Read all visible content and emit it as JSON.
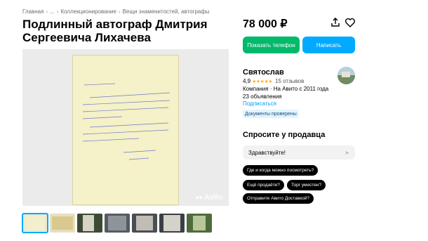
{
  "breadcrumbs": [
    "Главная",
    "...",
    "Коллекционирование",
    "Вещи знаменитостей, автографы"
  ],
  "listing": {
    "title": "Подлинный автограф Дмитрия Сергеевича Лихачева",
    "price": "78 000 ₽"
  },
  "actions": {
    "phone_label": "Показать телефон",
    "message_label": "Написать"
  },
  "watermark": "Avito",
  "seller": {
    "name": "Святослав",
    "rating": "4,9",
    "stars": "★★★★★",
    "reviews": "15 отзывов",
    "company_since": "Компания · На Авито с 2011 года",
    "ads": "23 объявления",
    "subscribe": "Подписаться",
    "verified": "Документы проверены"
  },
  "ask": {
    "title": "Спросите у продавца",
    "input_value": "Здравствуйте!",
    "questions": [
      "Где и когда можно посмотреть?",
      "Ещё продаёте?",
      "Торг уместен?",
      "Отправите Авито Доставкой?"
    ]
  },
  "colors": {
    "phone_button": "#00b96b",
    "message_button": "#00aaff",
    "link": "#009cf0",
    "star": "#ffb021"
  }
}
